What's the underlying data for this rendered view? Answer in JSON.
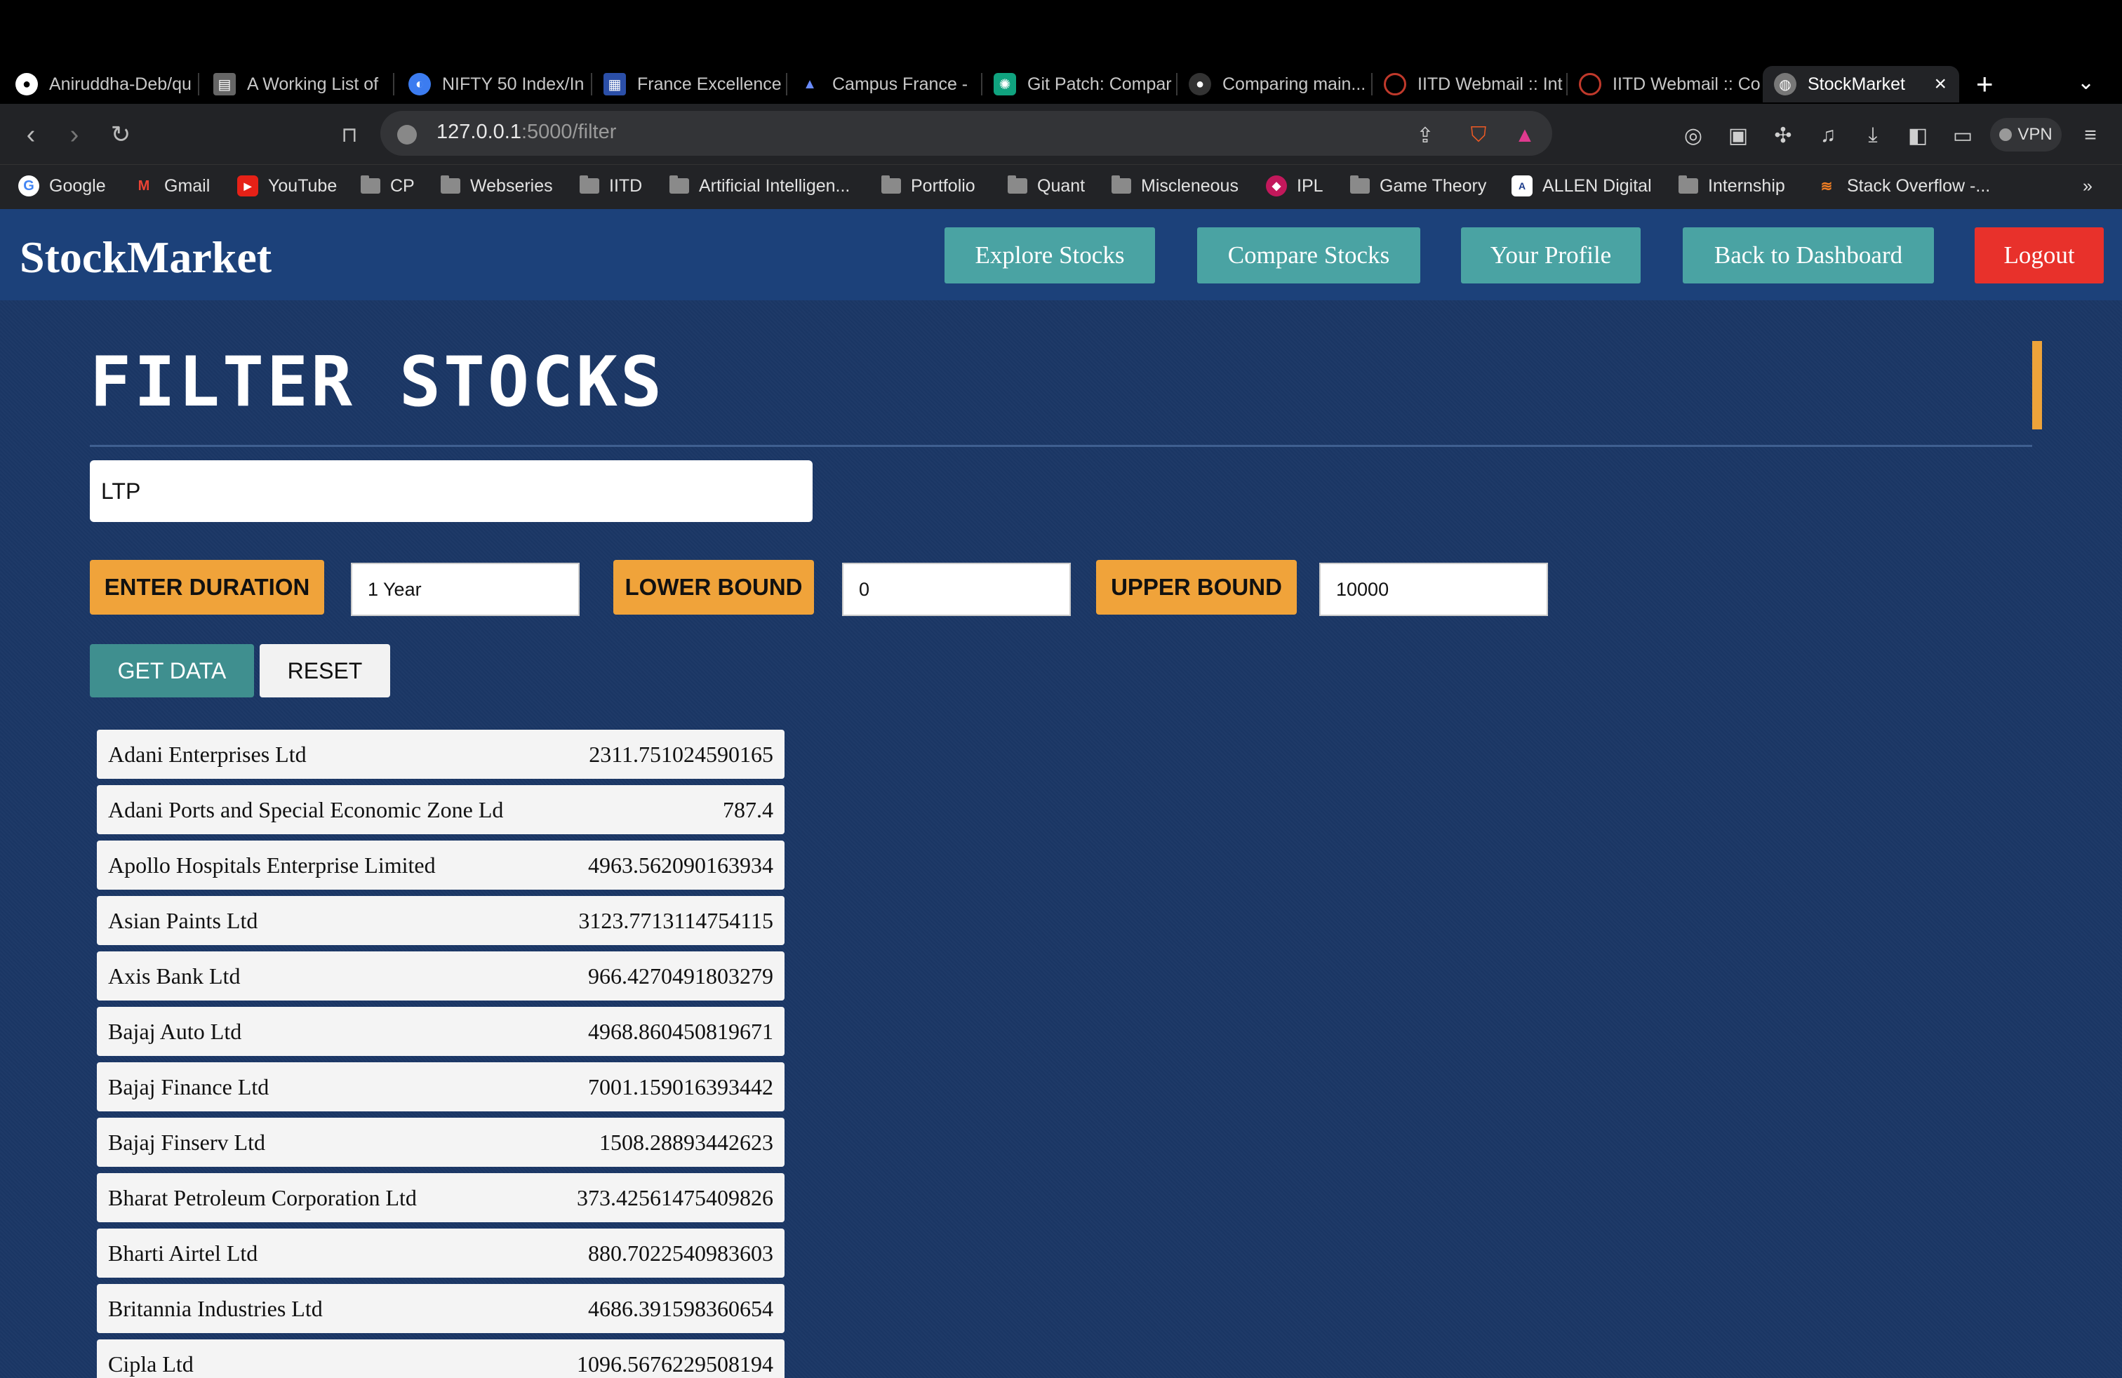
{
  "browser": {
    "tabs": [
      {
        "label": "Aniruddha-Deb/qu",
        "icon": "github-icon"
      },
      {
        "label": "A Working List of",
        "icon": "doc-icon"
      },
      {
        "label": "NIFTY 50 Index/In",
        "icon": "nifty-icon"
      },
      {
        "label": "France Excellence",
        "icon": "france-icon"
      },
      {
        "label": "Campus France -",
        "icon": "campus-icon"
      },
      {
        "label": "Git Patch: Compar",
        "icon": "chatgpt-icon"
      },
      {
        "label": "Comparing main...",
        "icon": "github-icon"
      },
      {
        "label": "IITD Webmail :: Int",
        "icon": "webmail-icon"
      },
      {
        "label": "IITD Webmail :: Co",
        "icon": "webmail-icon"
      },
      {
        "label": "StockMarket",
        "icon": "globe-icon"
      }
    ],
    "url_host": "127.0.0.1",
    "url_rest": ":5000/filter",
    "vpn_label": "VPN",
    "bookmarks": [
      {
        "label": "Google",
        "icon": "google-icon"
      },
      {
        "label": "Gmail",
        "icon": "gmail-icon"
      },
      {
        "label": "YouTube",
        "icon": "youtube-icon"
      },
      {
        "label": "CP",
        "icon": "folder-icon"
      },
      {
        "label": "Webseries",
        "icon": "folder-icon"
      },
      {
        "label": "IITD",
        "icon": "folder-icon"
      },
      {
        "label": "Artificial Intelligen...",
        "icon": "folder-icon"
      },
      {
        "label": "Portfolio",
        "icon": "folder-icon"
      },
      {
        "label": "Quant",
        "icon": "folder-icon"
      },
      {
        "label": "Miscleneous",
        "icon": "folder-icon"
      },
      {
        "label": "IPL",
        "icon": "ipl-icon"
      },
      {
        "label": "Game Theory",
        "icon": "folder-icon"
      },
      {
        "label": "ALLEN Digital",
        "icon": "allen-icon"
      },
      {
        "label": "Internship",
        "icon": "folder-icon"
      },
      {
        "label": "Stack Overflow -...",
        "icon": "stackoverflow-icon"
      }
    ],
    "more_bookmarks": "»"
  },
  "app": {
    "brand": "StockMarket",
    "nav": {
      "explore": "Explore Stocks",
      "compare": "Compare Stocks",
      "profile": "Your Profile",
      "dashboard": "Back to Dashboard",
      "logout": "Logout"
    },
    "page_title": "FILTER STOCKS",
    "search_value": "LTP",
    "filters": {
      "duration_label": "ENTER DURATION",
      "duration_value": "1 Year",
      "lower_label": "LOWER BOUND",
      "lower_value": "0",
      "upper_label": "UPPER BOUND",
      "upper_value": "10000"
    },
    "buttons": {
      "get_data": "GET DATA",
      "reset": "RESET"
    },
    "results": [
      {
        "name": "Adani Enterprises Ltd",
        "value": "2311.751024590165"
      },
      {
        "name": "Adani Ports and Special Economic Zone Ld",
        "value": "787.4"
      },
      {
        "name": "Apollo Hospitals Enterprise Limited",
        "value": "4963.562090163934"
      },
      {
        "name": "Asian Paints Ltd",
        "value": "3123.7713114754115"
      },
      {
        "name": "Axis Bank Ltd",
        "value": "966.4270491803279"
      },
      {
        "name": "Bajaj Auto Ltd",
        "value": "4968.860450819671"
      },
      {
        "name": "Bajaj Finance Ltd",
        "value": "7001.159016393442"
      },
      {
        "name": "Bajaj Finserv Ltd",
        "value": "1508.28893442623"
      },
      {
        "name": "Bharat Petroleum Corporation Ltd",
        "value": "373.42561475409826"
      },
      {
        "name": "Bharti Airtel Ltd",
        "value": "880.7022540983603"
      },
      {
        "name": "Britannia Industries Ltd",
        "value": "4686.391598360654"
      },
      {
        "name": "Cipla Ltd",
        "value": "1096.5676229508194"
      }
    ]
  }
}
